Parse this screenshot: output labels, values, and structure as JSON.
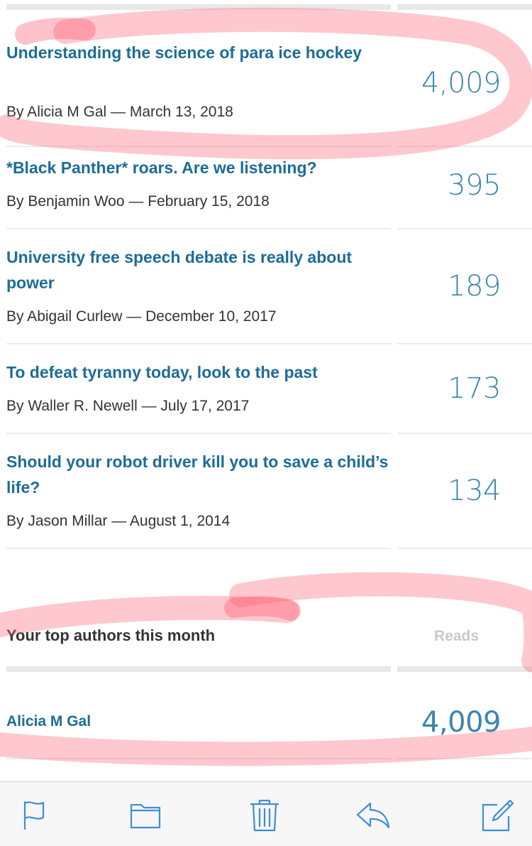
{
  "articles": [
    {
      "title": "Understanding the science of para ice hockey",
      "byline": "By Alicia M Gal — March 13, 2018",
      "reads": "4,009"
    },
    {
      "title": "*Black Panther* roars. Are we listening?",
      "byline": "By Benjamin Woo — February 15, 2018",
      "reads": "395"
    },
    {
      "title": "University free speech debate is really about power",
      "byline": "By Abigail Curlew — December 10, 2017",
      "reads": "189"
    },
    {
      "title": "To defeat tyranny today, look to the past",
      "byline": "By Waller R. Newell — July 17, 2017",
      "reads": "173"
    },
    {
      "title": "Should your robot driver kill you to save a child’s life?",
      "byline": "By Jason Millar — August 1, 2014",
      "reads": "134"
    }
  ],
  "authors_section": {
    "title": "Your top authors this month",
    "reads_header": "Reads",
    "authors": [
      {
        "name": "Alicia M Gal",
        "reads": "4,009"
      }
    ]
  },
  "toolbar": {
    "icons": [
      "flag-icon",
      "folder-icon",
      "trash-icon",
      "reply-icon",
      "compose-icon"
    ]
  },
  "colors": {
    "link_blue": "#1d6c97",
    "reads_blue": "#3b87ad",
    "toolbar_icon_blue": "#3d8ed8",
    "highlighter_red": "#ff6e7f"
  }
}
